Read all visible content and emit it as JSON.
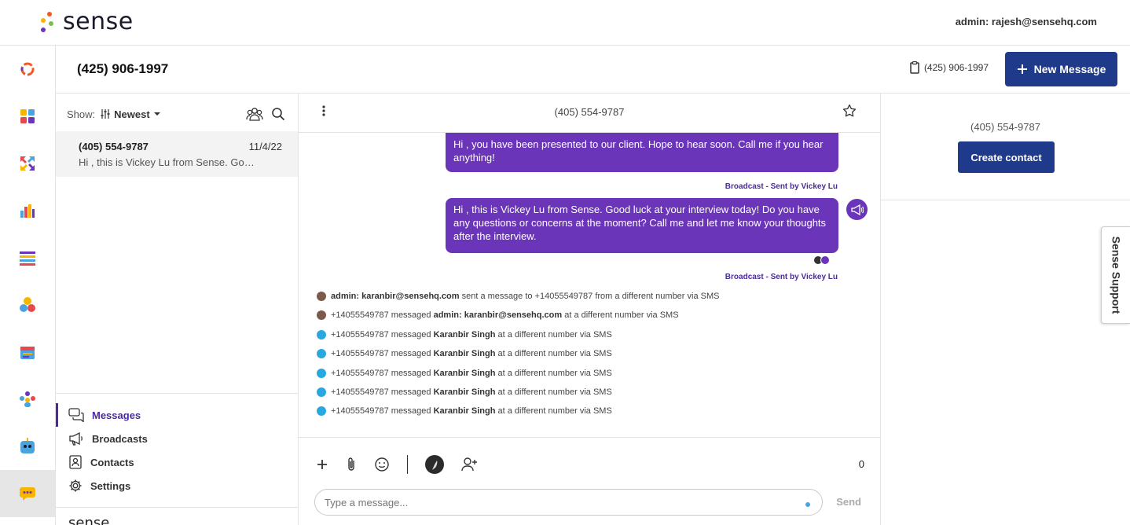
{
  "app": {
    "name": "sense",
    "admin_email": "admin: rajesh@sensehq.com"
  },
  "phonebar": {
    "title": "(425) 906-1997",
    "line_number": "(425) 906-1997",
    "new_message_label": "New Message"
  },
  "list": {
    "show_label": "Show:",
    "sort_label": "Newest",
    "conversations": [
      {
        "name": "(405) 554-9787",
        "date": "11/4/22",
        "preview": "Hi , this is Vickey Lu from Sense. Good luck at your interview today!"
      }
    ],
    "nav": [
      {
        "label": "Messages"
      },
      {
        "label": "Broadcasts"
      },
      {
        "label": "Contacts"
      },
      {
        "label": "Settings"
      }
    ],
    "footer_logo": "sense"
  },
  "chat": {
    "title": "(405) 554-9787",
    "messages": [
      {
        "text": "Hi , you have been presented to our client. Hope to hear soon. Call me if you hear anything!",
        "meta": "Broadcast - Sent by Vickey Lu"
      },
      {
        "text": "Hi , this is Vickey Lu from Sense. Good luck at your interview today! Do you have any questions or concerns at the moment? Call me and let me know your thoughts after the interview.",
        "meta": "Broadcast - Sent by Vickey Lu"
      }
    ],
    "log": [
      {
        "pre": "",
        "bold": "admin: karanbir@sensehq.com",
        "post": " sent a message to +14055549787 from a different number via SMS"
      },
      {
        "pre": "+14055549787 messaged ",
        "bold": "admin: karanbir@sensehq.com",
        "post": " at a different number via SMS"
      },
      {
        "pre": "+14055549787 messaged ",
        "bold": "Karanbir Singh",
        "post": " at a different number via SMS"
      },
      {
        "pre": "+14055549787 messaged ",
        "bold": "Karanbir Singh",
        "post": " at a different number via SMS"
      },
      {
        "pre": "+14055549787 messaged ",
        "bold": "Karanbir Singh",
        "post": " at a different number via SMS"
      },
      {
        "pre": "+14055549787 messaged ",
        "bold": "Karanbir Singh",
        "post": " at a different number via SMS"
      },
      {
        "pre": "+14055549787 messaged ",
        "bold": "Karanbir Singh",
        "post": " at a different number via SMS"
      }
    ],
    "composer": {
      "placeholder": "Type a message...",
      "char_count": "0",
      "send_label": "Send"
    }
  },
  "contact_panel": {
    "phone": "(405) 554-9787",
    "create_label": "Create contact"
  },
  "support": {
    "label": "Sense Support"
  },
  "colors": {
    "primary": "#1f3a8a",
    "bubble": "#6a35b8",
    "accent": "#4b2a9c"
  }
}
